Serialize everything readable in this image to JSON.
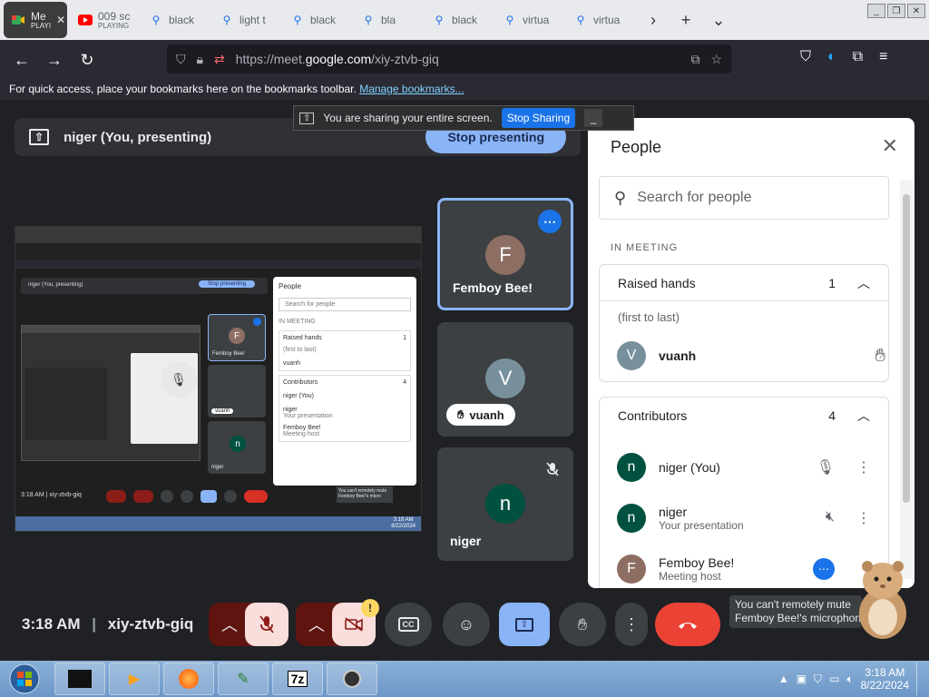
{
  "browser": {
    "tabs": [
      {
        "label": "Me",
        "sub": "PLAYI",
        "icon": "meet-icon",
        "active": true
      },
      {
        "label": "009 sc",
        "sub": "PLAYING",
        "icon": "youtube-icon"
      },
      {
        "label": "black",
        "icon": "search-icon"
      },
      {
        "label": "light t",
        "icon": "search-icon"
      },
      {
        "label": "black",
        "icon": "search-icon"
      },
      {
        "label": "bla",
        "icon": "search-icon"
      },
      {
        "label": "black",
        "icon": "search-icon"
      },
      {
        "label": "virtua",
        "icon": "search-icon"
      },
      {
        "label": "virtua",
        "icon": "search-icon"
      }
    ],
    "url_prefix": "https://meet.",
    "url_domain": "google.com",
    "url_path": "/xiy-ztvb-giq",
    "bookmarks_text": "For quick access, place your bookmarks here on the bookmarks toolbar.",
    "bookmarks_link": "Manage bookmarks..."
  },
  "share_bar": {
    "message": "You are sharing your entire screen.",
    "stop_label": "Stop Sharing"
  },
  "presenting": {
    "label": "niger (You, presenting)",
    "stop_label": "Stop presenting"
  },
  "tiles": [
    {
      "name": "Femboy Bee!",
      "initial": "F",
      "color": "#8d6e63"
    },
    {
      "name": "vuanh",
      "initial": "V",
      "color": "#78909c"
    },
    {
      "name": "niger",
      "initial": "n",
      "color": "#00513f"
    }
  ],
  "people_panel": {
    "title": "People",
    "search_placeholder": "Search for people",
    "in_meeting": "IN MEETING",
    "raised_hands": {
      "label": "Raised hands",
      "count": "1",
      "order_note": "(first to last)",
      "people": [
        {
          "name": "vuanh",
          "initial": "V",
          "color": "#78909c"
        }
      ]
    },
    "contributors": {
      "label": "Contributors",
      "count": "4",
      "people": [
        {
          "name": "niger (You)",
          "sub": "",
          "initial": "n",
          "color": "#00513f"
        },
        {
          "name": "niger",
          "sub": "Your presentation",
          "initial": "n",
          "color": "#00513f"
        },
        {
          "name": "Femboy Bee!",
          "sub": "Meeting host",
          "initial": "F",
          "color": "#8d6e63"
        }
      ]
    }
  },
  "bottom": {
    "time": "3:18 AM",
    "meeting_code": "xiy-ztvb-giq",
    "tooltip_line1": "You can't remotely mute",
    "tooltip_line2": "Femboy Bee!'s microphone"
  },
  "mini_screen": {
    "people_title": "People",
    "search": "Search for people",
    "in_meeting": "IN MEETING",
    "raised_hands": "Raised hands",
    "raised_count": "1",
    "order_note": "(first to last)",
    "vuanh": "vuanh",
    "contributors": "Contributors",
    "contrib_count": "4",
    "p1": "niger (You)",
    "p2": "niger",
    "p2sub": "Your presentation",
    "p3": "Femboy Bee!",
    "p3sub": "Meeting host",
    "clock": "3:18 AM",
    "code": "xiy-ztvb-giq",
    "tile1": "Femboy Bee!",
    "tile2": "vuanh",
    "tile3": "niger",
    "presenting": "niger (You, presenting)",
    "stop": "Stop presenting",
    "tooltip": "You can't remotely mute Femboy Bee!'s micro",
    "date": "8/22/2024",
    "time": "3:18 AM"
  },
  "taskbar": {
    "time": "3:18 AM",
    "date": "8/22/2024",
    "apps": [
      "start-orb",
      "terminal-app",
      "media-player-app",
      "firefox-app",
      "notepad-app",
      "7zip-app",
      "obs-app"
    ]
  }
}
